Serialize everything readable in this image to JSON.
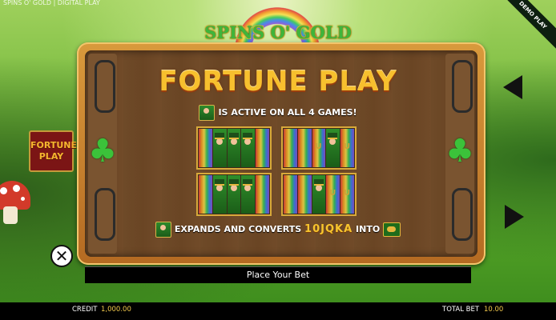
{
  "window_title": "SPINS O' GOLD | DIGITAL PLAY",
  "ribbon": "DEMO PLAY",
  "logo_text": "SPINS O' GOLD",
  "info_panel": {
    "title": "FORTUNE PLAY",
    "active_text": "IS ACTIVE ON ALL 4 GAMES!",
    "expands_text": "EXPANDS AND CONVERTS",
    "royals_text": "10JQKA",
    "into_text": "INTO"
  },
  "side_button_label": "FORTUNE PLAY",
  "place_bet_label": "Place Your Bet",
  "footer": {
    "credit_label": "CREDIT",
    "credit_value": "1,000.00",
    "total_bet_label": "TOTAL BET",
    "total_bet_value": "10.00"
  },
  "icons": [
    "close-icon",
    "arrow-left-icon",
    "arrow-right-icon",
    "clover-icon",
    "leprechaun-icon",
    "pot-of-gold-icon"
  ],
  "colors": {
    "accent_gold": "#f7c02e",
    "panel_wood": "#6e4a28",
    "button_red": "#7b1515"
  }
}
